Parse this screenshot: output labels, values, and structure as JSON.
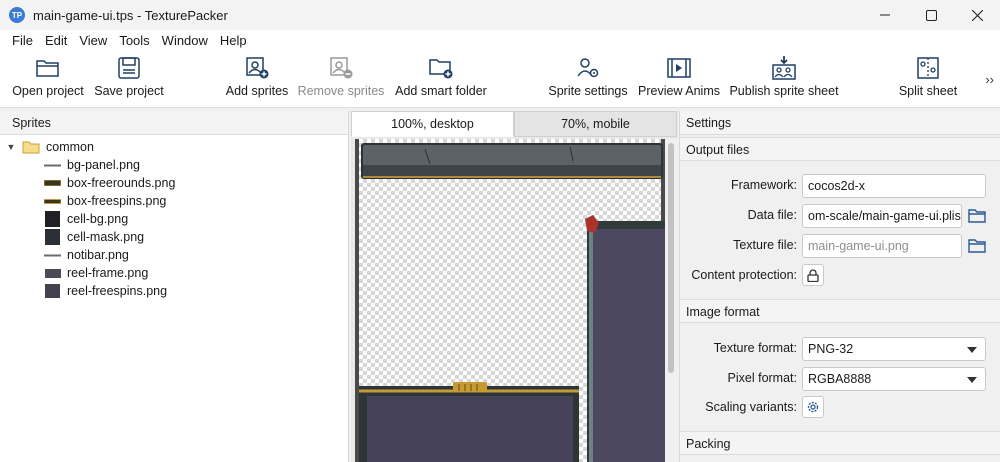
{
  "window": {
    "app_icon_text": "TP",
    "title": "main-game-ui.tps - TexturePacker"
  },
  "menu": [
    {
      "label": "File"
    },
    {
      "label": "Edit"
    },
    {
      "label": "View"
    },
    {
      "label": "Tools"
    },
    {
      "label": "Window"
    },
    {
      "label": "Help"
    }
  ],
  "toolbar": {
    "open_project": "Open project",
    "save_project": "Save project",
    "add_sprites": "Add sprites",
    "remove_sprites": "Remove sprites",
    "add_smart_folder": "Add smart folder",
    "sprite_settings": "Sprite settings",
    "preview_anims": "Preview Anims",
    "publish_sprite_sheet": "Publish sprite sheet",
    "split_sheet": "Split sheet",
    "more": "››"
  },
  "sprites_panel": {
    "header": "Sprites",
    "folder": "common",
    "items": [
      {
        "label": "bg-panel.png",
        "thumb": "line"
      },
      {
        "label": "box-freerounds.png",
        "thumb": "bar-gold"
      },
      {
        "label": "box-freespins.png",
        "thumb": "bar-gold-small"
      },
      {
        "label": "cell-bg.png",
        "thumb": "dark-square"
      },
      {
        "label": "cell-mask.png",
        "thumb": "dark-square-alt"
      },
      {
        "label": "notibar.png",
        "thumb": "line"
      },
      {
        "label": "reel-frame.png",
        "thumb": "frame"
      },
      {
        "label": "reel-freespins.png",
        "thumb": "frame"
      }
    ]
  },
  "preview": {
    "tabs": [
      {
        "label": "100%, desktop",
        "active": true
      },
      {
        "label": "70%, mobile",
        "active": false
      }
    ]
  },
  "settings": {
    "header": "Settings",
    "output_files": {
      "header": "Output files",
      "framework_label": "Framework:",
      "framework_value": "cocos2d-x",
      "data_file_label": "Data file:",
      "data_file_value": "om-scale/main-game-ui.plist",
      "texture_file_label": "Texture file:",
      "texture_file_placeholder": "main-game-ui.png",
      "content_protection_label": "Content protection:"
    },
    "image_format": {
      "header": "Image format",
      "texture_format_label": "Texture format:",
      "texture_format_value": "PNG-32",
      "pixel_format_label": "Pixel format:",
      "pixel_format_value": "RGBA8888",
      "scaling_variants_label": "Scaling variants:"
    },
    "packing": {
      "header": "Packing"
    }
  }
}
